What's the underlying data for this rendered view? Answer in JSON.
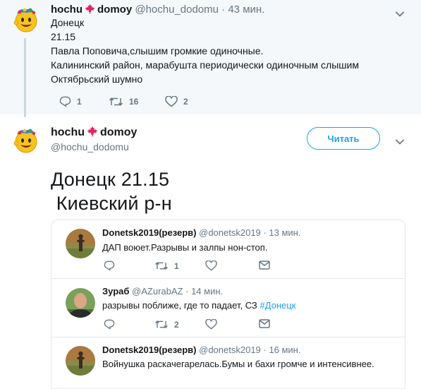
{
  "reply": {
    "name": "hochu",
    "name2": "domoy",
    "handle": "@hochu_dodomu",
    "dot": "·",
    "time": "43 мин.",
    "text": "Донецк\n21.15\nПавла Поповича,слышим громкие одиночные.\nКалининский район, марабушта периодически одиночным слышим\nОктябрьский шумно",
    "replies": "1",
    "retweets": "16",
    "likes": "2"
  },
  "main": {
    "name": "hochu",
    "name2": "domoy",
    "handle": "@hochu_dodomu",
    "follow_label": "Читать",
    "line1": "Донецк 21.15",
    "line2": " Киевский р-н"
  },
  "quoted": [
    {
      "name": "Donetsk2019(резерв)",
      "handle": "@donetsk2019",
      "dot": "·",
      "time": "13 мин.",
      "text": "ДАП воюет.Разрывы и залпы нон-стоп.",
      "retweets": "1"
    },
    {
      "name": "Зураб",
      "handle": "@AZurabAZ",
      "dot": "·",
      "time": "14 мин.",
      "text": "разрывы поближе, где то падает, СЗ ",
      "hashtag": "#Донецк",
      "retweets": "2"
    },
    {
      "name": "Donetsk2019(резерв)",
      "handle": "@donetsk2019",
      "dot": "·",
      "time": "16 мин.",
      "text": "Войнушка раскачегарелась.Бумы и бахи громче и интенсивнее."
    }
  ],
  "colors": {
    "accent": "#1da1f2",
    "leaf": "#e0245e",
    "muted": "#657786",
    "band": "#f5f8fa"
  }
}
